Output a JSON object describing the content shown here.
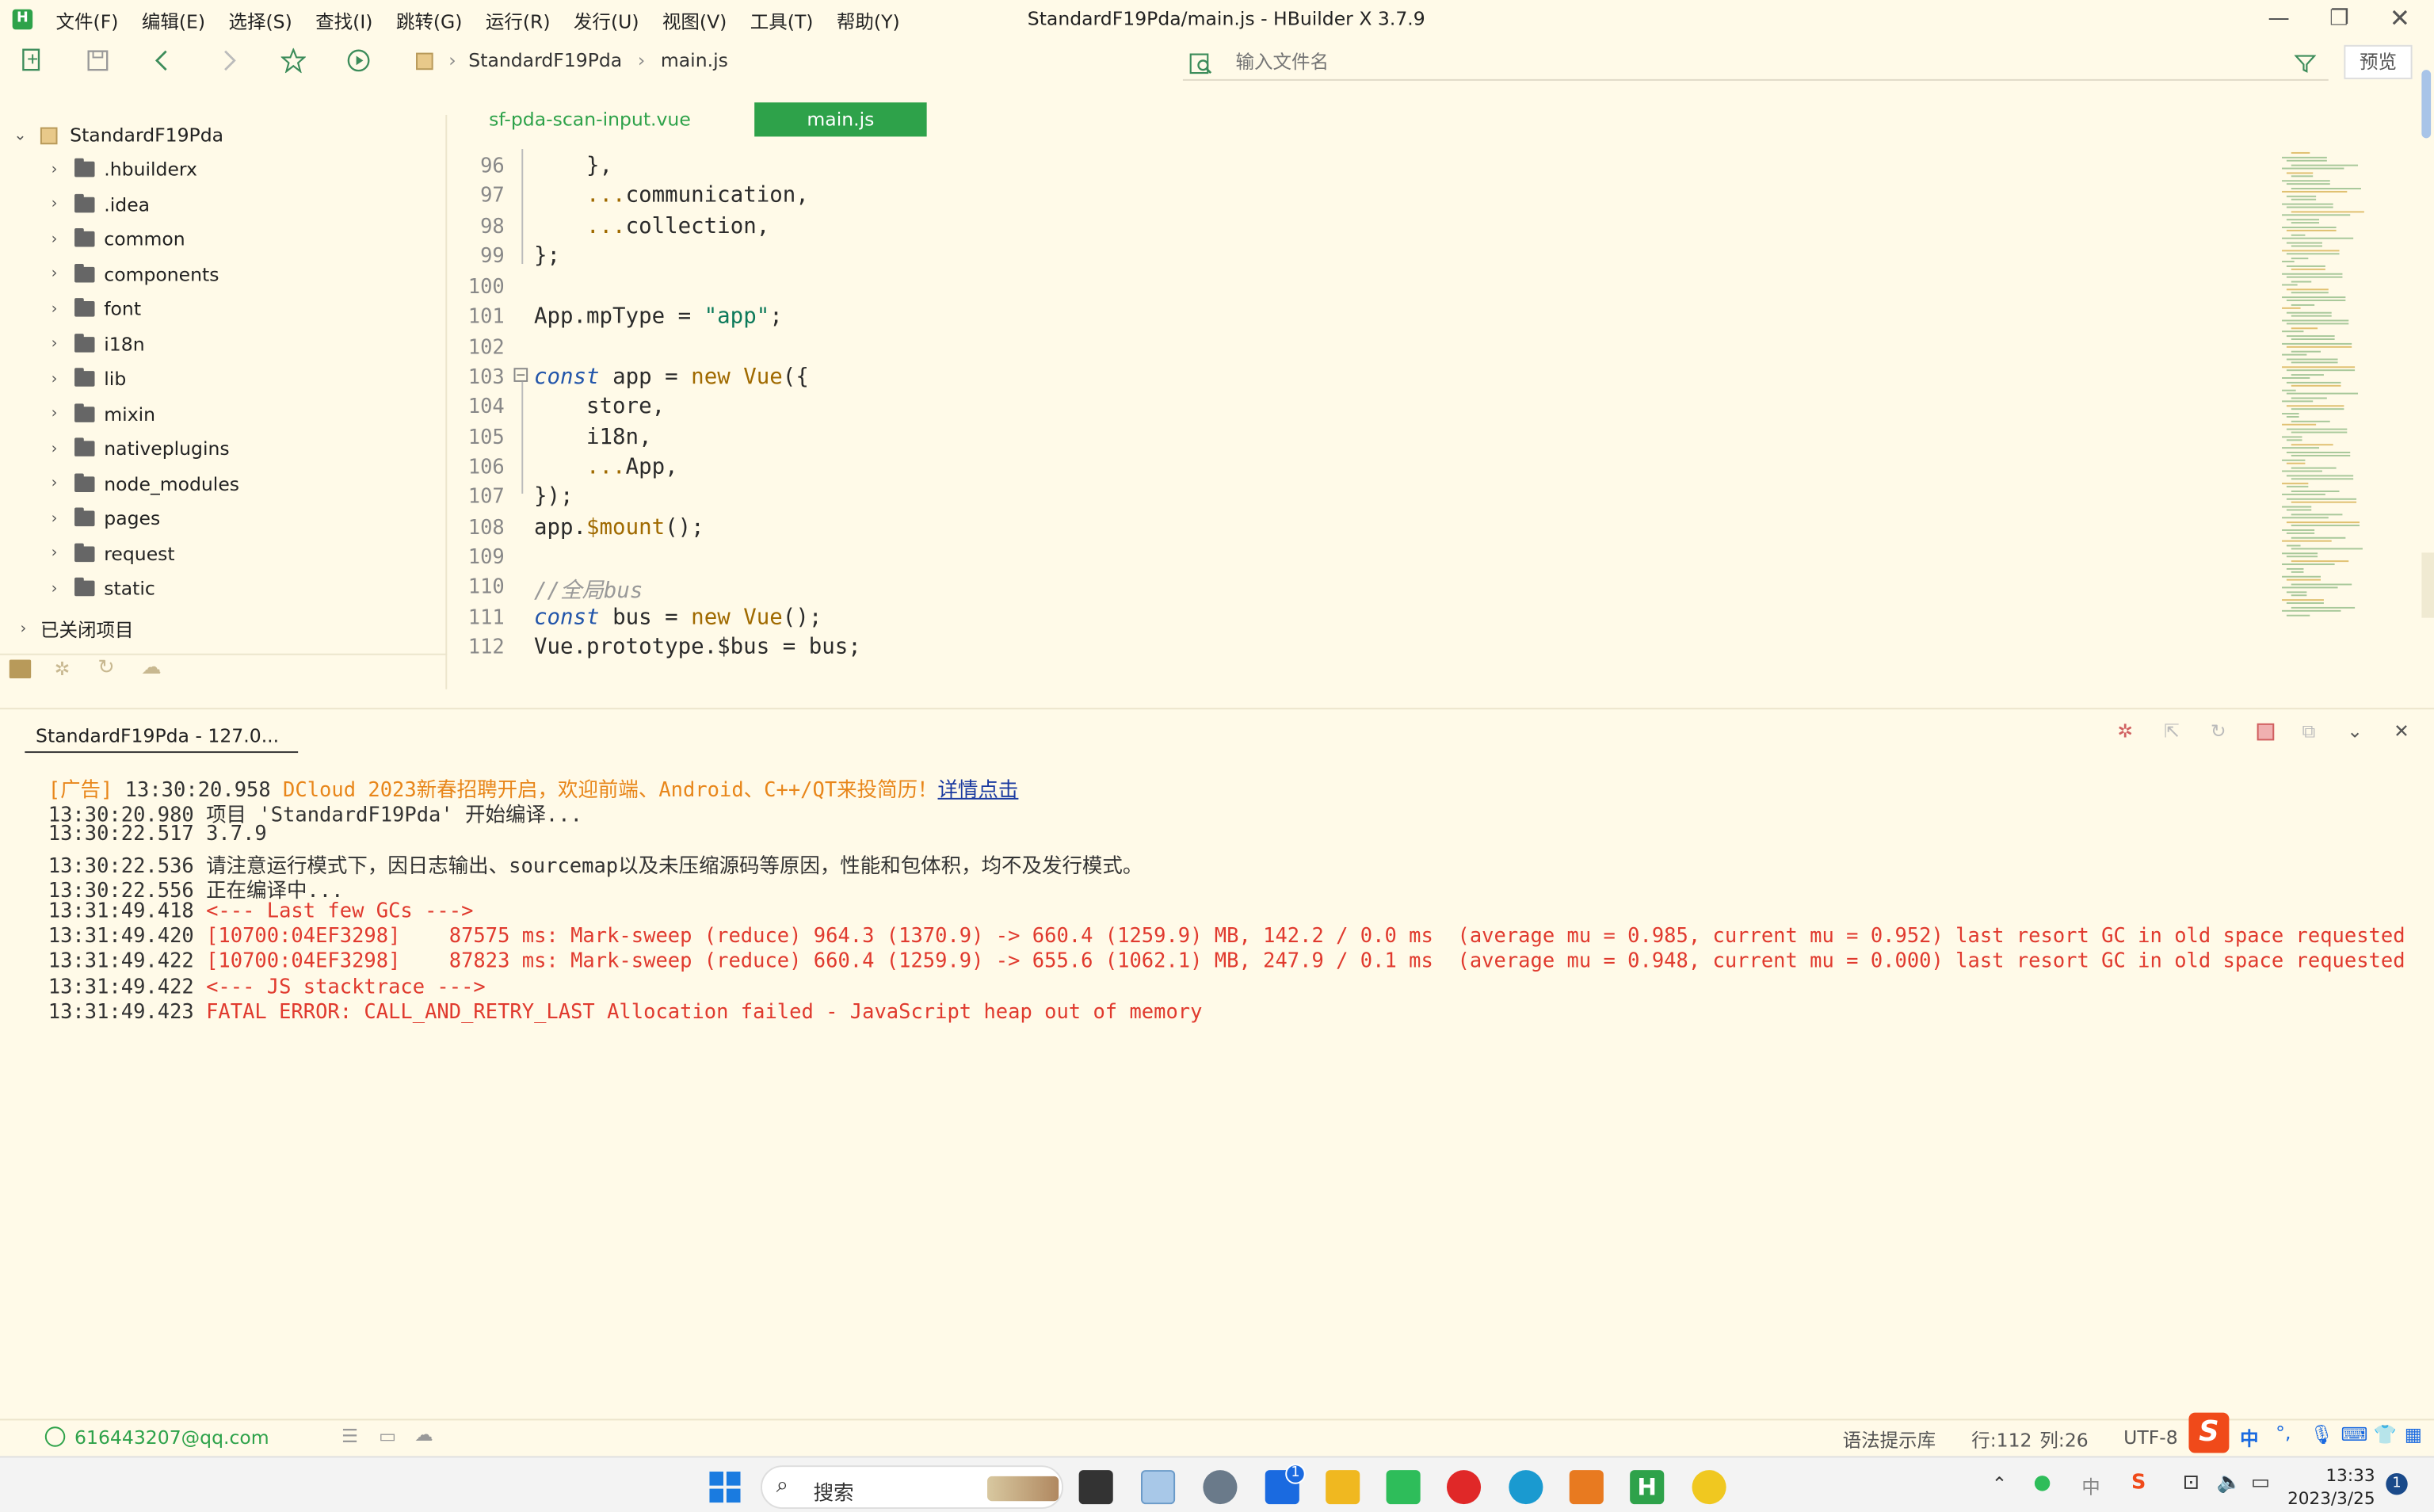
{
  "menu": {
    "items": [
      "文件(F)",
      "编辑(E)",
      "选择(S)",
      "查找(I)",
      "跳转(G)",
      "运行(R)",
      "发行(U)",
      "视图(V)",
      "工具(T)",
      "帮助(Y)"
    ],
    "title": "StandardF19Pda/main.js - HBuilder X 3.7.9"
  },
  "toolbar": {
    "crumb_project": "StandardF19Pda",
    "crumb_file": "main.js",
    "search_placeholder": "输入文件名",
    "preview_label": "预览"
  },
  "sidebar": {
    "project": "StandardF19Pda",
    "folders": [
      ".hbuilderx",
      ".idea",
      "common",
      "components",
      "font",
      "i18n",
      "lib",
      "mixin",
      "nativeplugins",
      "node_modules",
      "pages",
      "request",
      "static"
    ],
    "closed_projects": "已关闭项目"
  },
  "tabs": [
    {
      "label": "sf-pda-scan-input.vue",
      "active": false
    },
    {
      "label": "main.js",
      "active": true
    }
  ],
  "editor": {
    "line_numbers": [
      "96",
      "97",
      "98",
      "99",
      "100",
      "101",
      "102",
      "103",
      "104",
      "105",
      "106",
      "107",
      "108",
      "109",
      "110",
      "111",
      "112"
    ],
    "lines": {
      "l96": "    },",
      "l97_spread": "    ...",
      "l97_name": "communication,",
      "l98_spread": "    ...",
      "l98_name": "collection,",
      "l99": "};",
      "l101_a": "App.mpType = ",
      "l101_s": "\"app\"",
      "l101_b": ";",
      "l103_kw": "const",
      "l103_a": " app = ",
      "l103_new": "new",
      "l103_cls": " Vue",
      "l103_b": "({",
      "l104": "    store,",
      "l105": "    i18n,",
      "l106_spread": "    ...",
      "l106_name": "App,",
      "l107": "});",
      "l108_a": "app.",
      "l108_m": "$mount",
      "l108_b": "();",
      "l110": "//全局bus",
      "l111_kw": "const",
      "l111_a": " bus = ",
      "l111_new": "new",
      "l111_cls": " Vue",
      "l111_b": "();",
      "l112": "Vue.prototype.$bus = bus;"
    }
  },
  "console": {
    "tab": "StandardF19Pda - 127.0...",
    "ad_prefix": "[广告] ",
    "ad_time": "13:30:20.958 ",
    "ad_text": "DCloud 2023新春招聘开启，欢迎前端、Android、C++/QT来投简历！",
    "ad_link": "详情点击",
    "lines": [
      {
        "time": "13:30:20.980",
        "text": " 项目 'StandardF19Pda' 开始编译...",
        "color": "normal"
      },
      {
        "time": "13:30:22.517",
        "text": " 3.7.9",
        "color": "normal"
      },
      {
        "time": "13:30:22.536",
        "text": " 请注意运行模式下，因日志输出、sourcemap以及未压缩源码等原因，性能和包体积，均不及发行模式。",
        "color": "normal"
      },
      {
        "time": "13:30:22.556",
        "text": " 正在编译中...",
        "color": "normal"
      },
      {
        "time": "13:31:49.418",
        "text": " <--- Last few GCs --->",
        "color": "red"
      },
      {
        "time": "13:31:49.420",
        "text": " [10700:04EF3298]    87575 ms: Mark-sweep (reduce) 964.3 (1370.9) -> 660.4 (1259.9) MB, 142.2 / 0.0 ms  (average mu = 0.985, current mu = 0.952) last resort GC in old space requested",
        "color": "red"
      },
      {
        "time": "13:31:49.422",
        "text": " [10700:04EF3298]    87823 ms: Mark-sweep (reduce) 660.4 (1259.9) -> 655.6 (1062.1) MB, 247.9 / 0.1 ms  (average mu = 0.948, current mu = 0.000) last resort GC in old space requested",
        "color": "red"
      },
      {
        "time": "13:31:49.422",
        "text": " <--- JS stacktrace --->",
        "color": "red"
      },
      {
        "time": "13:31:49.423",
        "text": " FATAL ERROR: CALL_AND_RETRY_LAST Allocation failed - JavaScript heap out of memory",
        "color": "red"
      }
    ]
  },
  "status": {
    "account": "616443207@qq.com",
    "syntax_hint": "语法提示库",
    "row": "行:112",
    "col": "列:26",
    "encoding": "UTF-8",
    "ime": "中"
  },
  "taskbar": {
    "search_label": "搜索",
    "mail_badge": "1",
    "time": "13:33",
    "date": "2023/3/25",
    "notify_badge": "1",
    "tray_ime": "中"
  },
  "colors": {
    "bg": "#fffae8",
    "accent_green": "#2ea24a",
    "error_red": "#e03a2e",
    "ad_orange": "#e8861a"
  }
}
